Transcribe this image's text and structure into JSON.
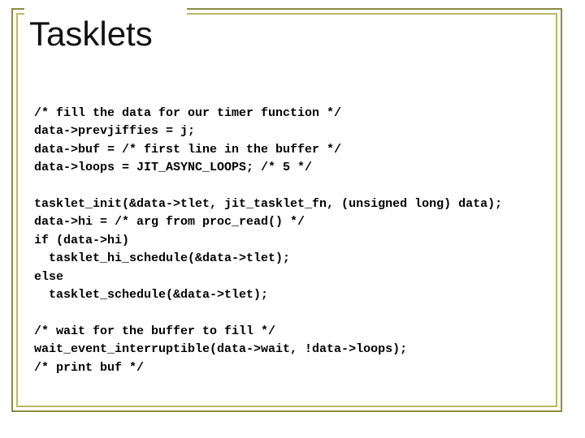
{
  "title": "Tasklets",
  "code": {
    "block1": {
      "l1": "/* fill the data for our timer function */",
      "l2": "data->prevjiffies = j;",
      "l3": "data->buf = /* first line in the buffer */",
      "l4": "data->loops = JIT_ASYNC_LOOPS; /* 5 */"
    },
    "block2": {
      "l1": "tasklet_init(&data->tlet, jit_tasklet_fn, (unsigned long) data);",
      "l2": "data->hi = /* arg from proc_read() */",
      "l3": "if (data->hi)",
      "l4": "  tasklet_hi_schedule(&data->tlet);",
      "l5": "else",
      "l6": "  tasklet_schedule(&data->tlet);"
    },
    "block3": {
      "l1": "/* wait for the buffer to fill */",
      "l2": "wait_event_interruptible(data->wait, !data->loops);",
      "l3": "/* print buf */"
    }
  }
}
